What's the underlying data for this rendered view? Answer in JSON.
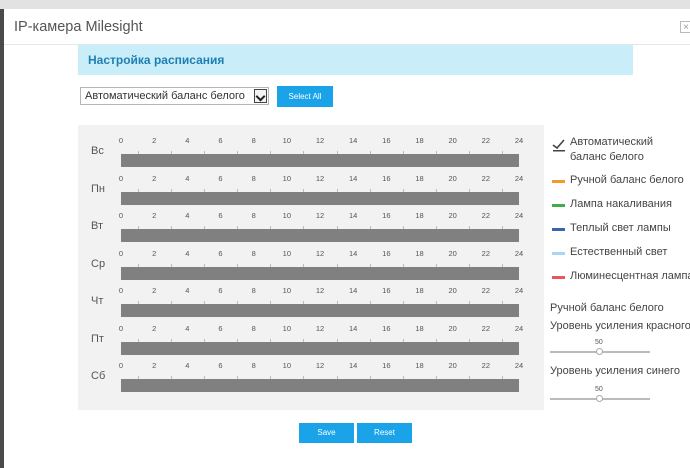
{
  "window": {
    "title": "IP-камера Milesight",
    "close_symbol": "×"
  },
  "section": {
    "title": "Настройка расписания"
  },
  "mode_select": {
    "value": "Автоматический баланс белого"
  },
  "buttons": {
    "select_all": "Select All",
    "save": "Save",
    "reset": "Reset"
  },
  "schedule": {
    "hour_ticks": [
      "0",
      "2",
      "4",
      "6",
      "8",
      "10",
      "12",
      "14",
      "16",
      "18",
      "20",
      "22",
      "24"
    ],
    "days": [
      {
        "label": "Вс"
      },
      {
        "label": "Пн"
      },
      {
        "label": "Вт"
      },
      {
        "label": "Ср"
      },
      {
        "label": "Чт"
      },
      {
        "label": "Пт"
      },
      {
        "label": "Сб"
      }
    ],
    "bar_color": "#808080"
  },
  "legend": {
    "selected_icon": "checkmark-icon",
    "items": [
      {
        "label_line1": "Автоматический",
        "label_line2": "баланс белого",
        "color": "#444444"
      },
      {
        "label": "Ручной баланс белого",
        "color": "#f29a2e"
      },
      {
        "label": "Лампа накаливания",
        "color": "#3fae49"
      },
      {
        "label": "Теплый свет лампы",
        "color": "#3a64b0"
      },
      {
        "label": "Естественный свет",
        "color": "#a9d7f3"
      },
      {
        "label": "Люминесцентная лампа",
        "color": "#e8555f"
      }
    ]
  },
  "manual_wb": {
    "title": "Ручной баланс белого",
    "red_gain": {
      "label": "Уровень усиления красного",
      "value": "50"
    },
    "blue_gain": {
      "label": "Уровень усиления синего",
      "value": "50"
    }
  }
}
